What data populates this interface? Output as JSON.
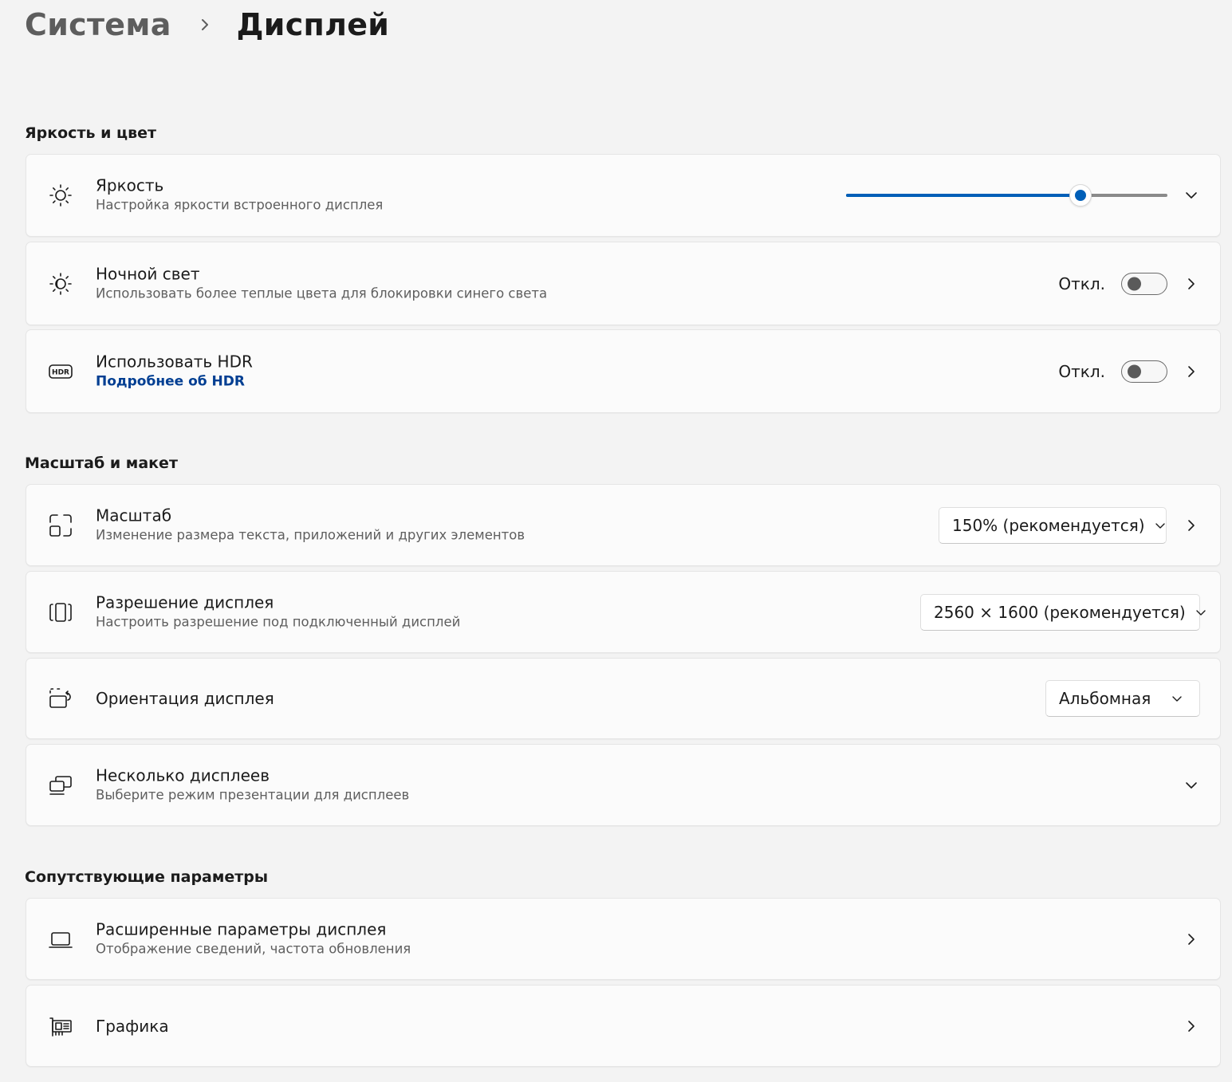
{
  "breadcrumb": {
    "parent": "Система",
    "current": "Дисплей"
  },
  "sections": {
    "brightness_color": "Яркость и цвет",
    "scale_layout": "Масштаб и макет",
    "related": "Сопутствующие параметры"
  },
  "brightness": {
    "title": "Яркость",
    "subtitle": "Настройка яркости встроенного дисплея",
    "level_percent": 73,
    "icon": "sun-icon"
  },
  "night_light": {
    "title": "Ночной свет",
    "subtitle": "Использовать более теплые цвета для блокировки синего света",
    "state": "Откл.",
    "icon": "night-light-icon"
  },
  "hdr": {
    "title": "Использовать HDR",
    "link": "Подробнее об HDR",
    "state": "Откл.",
    "icon": "hdr-icon"
  },
  "scale": {
    "title": "Масштаб",
    "subtitle": "Изменение размера текста, приложений и других элементов",
    "value": "150% (рекомендуется)",
    "icon": "scale-icon"
  },
  "resolution": {
    "title": "Разрешение дисплея",
    "subtitle": "Настроить разрешение под подключенный дисплей",
    "value": "2560 × 1600 (рекомендуется)",
    "icon": "resolution-icon"
  },
  "orientation": {
    "title": "Ориентация дисплея",
    "value": "Альбомная",
    "icon": "orientation-icon"
  },
  "multiple_displays": {
    "title": "Несколько дисплеев",
    "subtitle": "Выберите режим презентации для дисплеев",
    "icon": "multiple-displays-icon"
  },
  "advanced_display": {
    "title": "Расширенные параметры дисплея",
    "subtitle": "Отображение сведений, частота обновления",
    "icon": "laptop-icon"
  },
  "graphics": {
    "title": "Графика",
    "icon": "graphics-card-icon"
  },
  "colors": {
    "accent": "#005fb8",
    "link": "#003e92"
  }
}
